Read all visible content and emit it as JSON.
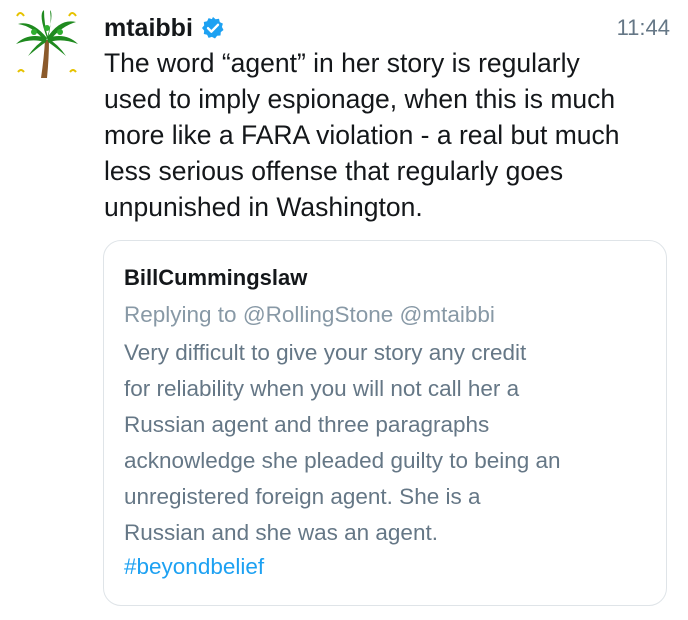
{
  "tweet": {
    "username": "mtaibbi",
    "time": "11:44",
    "text": "The word “agent” in her story is regularly\nused to imply espionage, when this is much\nmore like a FARA violation - a real but much\nless serious offense that regularly goes\nunpunished in Washington.",
    "avatar_icon": "palm-tree-icon",
    "verified_icon": "verified-badge-icon",
    "verified_color": "#1da1f2"
  },
  "quote": {
    "username": "BillCummingslaw",
    "replying_to": "Replying to @RollingStone @mtaibbi",
    "text": "Very difficult to give your story any credit\nfor reliability when you will not call her a\nRussian agent and three paragraphs\nacknowledge she pleaded guilty to being an\nunregistered foreign agent.  She is a\nRussian and she was an agent.",
    "hashtag": "#beyondbelief",
    "hashtag_color": "#1da1f2"
  }
}
